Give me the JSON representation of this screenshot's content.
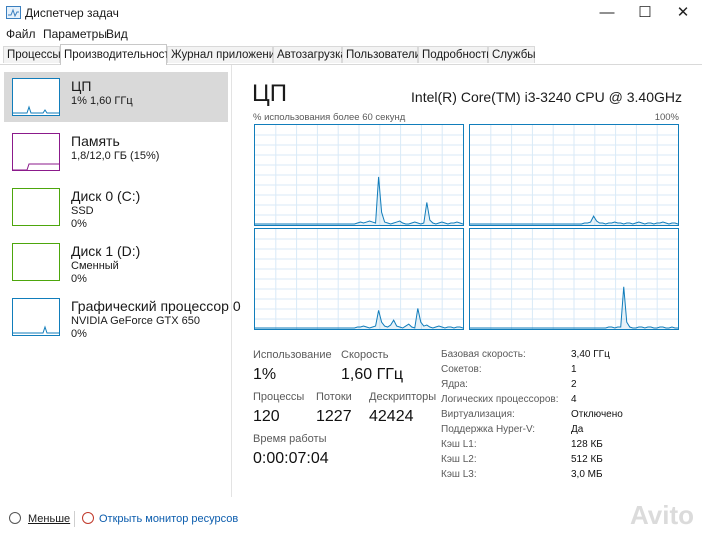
{
  "window": {
    "title": "Диспетчер задач",
    "buttons": {
      "minimize": "—",
      "maximize": "☐",
      "close": "✕"
    }
  },
  "menu": [
    "Файл",
    "Параметры",
    "Вид"
  ],
  "tabs": [
    "Процессы",
    "Производительность",
    "Журнал приложений",
    "Автозагрузка",
    "Пользователи",
    "Подробности",
    "Службы"
  ],
  "active_tab": "Производительность",
  "resources": [
    {
      "title": "ЦП",
      "lines": [
        "1% 1,60 ГГц"
      ],
      "color": "#117dbb",
      "selected": true
    },
    {
      "title": "Память",
      "lines": [
        "1,8/12,0 ГБ (15%)"
      ],
      "color": "#8b1a8b",
      "selected": false
    },
    {
      "title": "Диск 0 (C:)",
      "lines": [
        "SSD",
        "0%"
      ],
      "color": "#4da60c",
      "selected": false
    },
    {
      "title": "Диск 1 (D:)",
      "lines": [
        "Сменный",
        "0%"
      ],
      "color": "#4da60c",
      "selected": false
    },
    {
      "title": "Графический процессор 0",
      "lines": [
        "NVIDIA GeForce GTX 650",
        "0%"
      ],
      "color": "#117dbb",
      "selected": false
    }
  ],
  "detail": {
    "title": "ЦП",
    "cpu_name": "Intel(R) Core(TM) i3-3240 CPU @ 3.40GHz",
    "util_label": "% использования более 60 секунд",
    "util_max": "100%",
    "graph_color": "#117dbb",
    "graphs": [
      [
        0,
        0,
        0,
        0,
        0,
        0,
        0,
        0,
        0,
        0,
        0,
        0,
        0,
        0,
        0,
        0,
        0,
        0,
        0,
        0,
        0,
        0,
        0,
        0,
        0,
        0,
        0,
        0,
        0,
        0,
        0,
        0,
        0,
        0,
        1,
        2,
        1,
        2,
        3,
        2,
        1,
        48,
        12,
        2,
        1,
        0,
        1,
        2,
        3,
        1,
        0,
        0,
        1,
        2,
        1,
        0,
        1,
        22,
        4,
        1,
        0,
        1,
        2,
        1,
        0,
        1,
        1,
        2,
        1,
        0
      ],
      [
        0,
        0,
        0,
        0,
        0,
        0,
        0,
        0,
        0,
        0,
        0,
        0,
        0,
        0,
        0,
        0,
        0,
        0,
        0,
        0,
        0,
        0,
        0,
        0,
        0,
        0,
        0,
        0,
        0,
        0,
        0,
        0,
        0,
        0,
        0,
        0,
        0,
        0,
        1,
        1,
        2,
        8,
        3,
        1,
        1,
        0,
        1,
        1,
        2,
        1,
        1,
        0,
        1,
        1,
        0,
        1,
        2,
        1,
        0,
        1,
        1,
        0,
        1,
        1,
        2,
        1,
        0,
        1,
        1,
        0
      ],
      [
        0,
        0,
        0,
        0,
        0,
        0,
        0,
        0,
        0,
        0,
        0,
        0,
        0,
        0,
        0,
        0,
        0,
        0,
        0,
        0,
        0,
        0,
        0,
        0,
        0,
        0,
        0,
        0,
        0,
        0,
        0,
        0,
        0,
        0,
        1,
        1,
        2,
        1,
        0,
        1,
        2,
        18,
        6,
        2,
        1,
        3,
        8,
        2,
        1,
        0,
        2,
        4,
        1,
        0,
        20,
        6,
        2,
        3,
        1,
        0,
        1,
        2,
        1,
        0,
        1,
        1,
        0,
        1,
        1,
        0
      ],
      [
        0,
        0,
        0,
        0,
        0,
        0,
        0,
        0,
        0,
        0,
        0,
        0,
        0,
        0,
        0,
        0,
        0,
        0,
        0,
        0,
        0,
        0,
        0,
        0,
        0,
        0,
        0,
        0,
        0,
        0,
        0,
        0,
        0,
        0,
        0,
        0,
        0,
        0,
        0,
        0,
        0,
        0,
        0,
        0,
        0,
        0,
        1,
        1,
        0,
        1,
        1,
        42,
        6,
        1,
        0,
        0,
        1,
        1,
        0,
        1,
        1,
        0,
        0,
        1,
        1,
        0,
        0,
        1,
        0,
        0
      ]
    ],
    "stats": [
      {
        "label": "Использование",
        "value": "1%"
      },
      {
        "label": "Скорость",
        "value": "1,60 ГГц"
      },
      {
        "label": "Процессы",
        "value": "120"
      },
      {
        "label": "Потоки",
        "value": "1227"
      },
      {
        "label": "Дескрипторы",
        "value": "42424"
      },
      {
        "label": "Время работы",
        "value": "0:00:07:04"
      }
    ],
    "properties": [
      {
        "key": "Базовая скорость:",
        "value": "3,40 ГГц"
      },
      {
        "key": "Сокетов:",
        "value": "1"
      },
      {
        "key": "Ядра:",
        "value": "2"
      },
      {
        "key": "Логических процессоров:",
        "value": "4"
      },
      {
        "key": "Виртуализация:",
        "value": "Отключено"
      },
      {
        "key": "Поддержка Hyper-V:",
        "value": "Да"
      },
      {
        "key": "Кэш L1:",
        "value": "128 КБ"
      },
      {
        "key": "Кэш L2:",
        "value": "512 КБ"
      },
      {
        "key": "Кэш L3:",
        "value": "3,0 МБ"
      }
    ]
  },
  "footer": {
    "less": "Меньше",
    "monitor": "Открыть монитор ресурсов"
  },
  "watermark": "Avito"
}
